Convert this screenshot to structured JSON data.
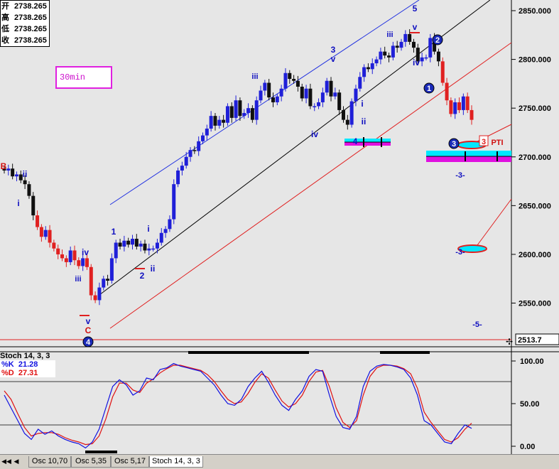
{
  "ohlc": {
    "open_label": "开",
    "open": "2738.265",
    "high_label": "高",
    "high": "2738.265",
    "low_label": "低",
    "low": "2738.265",
    "close_label": "收",
    "close": "2738.265"
  },
  "timeframe": "30min",
  "price_axis": {
    "ticks": [
      "2850.000",
      "2800.000",
      "2750.000",
      "2700.000",
      "2650.000",
      "2600.000",
      "2550.000"
    ],
    "current_price_tag": "2513.7",
    "ylim": [
      2505,
      2863
    ]
  },
  "stoch_axis": {
    "ticks": [
      "100.00",
      "50.00",
      "0.00"
    ]
  },
  "stoch_info": {
    "title": "Stoch 14, 3, 3",
    "k_label": "%K",
    "k_value": "21.28",
    "d_label": "%D",
    "d_value": "27.31"
  },
  "tabs": [
    "Osc 10,70",
    "Osc 5,35",
    "Osc 5,17",
    "Stoch 14, 3, 3"
  ],
  "active_tab": "Stoch 14, 3, 3",
  "wave_labels": [
    {
      "text": "B",
      "color": "#d01010"
    },
    {
      "text": "ii",
      "color": "#1010c0"
    },
    {
      "text": "i",
      "color": "#1010c0"
    },
    {
      "text": "iv",
      "color": "#1010c0"
    },
    {
      "text": "iii",
      "color": "#1010c0"
    },
    {
      "text": "v",
      "color": "#1010c0"
    },
    {
      "text": "C",
      "color": "#d01010"
    },
    {
      "text": "1",
      "color": "#1010c0"
    },
    {
      "text": "2",
      "color": "#1010c0"
    },
    {
      "text": "i",
      "color": "#1010c0"
    },
    {
      "text": "ii",
      "color": "#1010c0"
    },
    {
      "text": "iii",
      "color": "#1010c0"
    },
    {
      "text": "3",
      "color": "#1010c0"
    },
    {
      "text": "v",
      "color": "#1010c0"
    },
    {
      "text": "iv",
      "color": "#1010c0"
    },
    {
      "text": "4",
      "color": "#1010c0"
    },
    {
      "text": "i",
      "color": "#1010c0"
    },
    {
      "text": "ii",
      "color": "#1010c0"
    },
    {
      "text": "iii",
      "color": "#1010c0"
    },
    {
      "text": "v",
      "color": "#1010c0"
    },
    {
      "text": "5",
      "color": "#1010c0"
    },
    {
      "text": "iv",
      "color": "#1010c0"
    },
    {
      "text": "-3-",
      "color": "#1010c0"
    },
    {
      "text": "-3-",
      "color": "#1010c0"
    },
    {
      "text": "-5-",
      "color": "#1010c0"
    },
    {
      "text": "PTI",
      "color": "#d01010"
    }
  ],
  "circle_labels": [
    "4",
    "1",
    "2",
    "3"
  ],
  "colors": {
    "up": "#1f1fd8",
    "down": "#101010",
    "warn": "#e02020",
    "k": "#1010e0",
    "d": "#e01010",
    "cyan": "#00e8ff",
    "magenta": "#e010e0"
  },
  "chart_data": [
    {
      "type": "line",
      "title": "",
      "xlabel": "",
      "ylabel": "",
      "ylim": [
        2505,
        2863
      ],
      "series": [
        {
          "name": "",
          "values": [
            2686,
            2688,
            2680,
            2682,
            2676,
            2672,
            2660,
            2640,
            2628,
            2618,
            2625,
            2612,
            2606,
            2600,
            2596,
            2592,
            2604,
            2594,
            2588,
            2596,
            2587,
            2558,
            2553,
            2566,
            2575,
            2573,
            2596,
            2612,
            2608,
            2614,
            2610,
            2616,
            2608,
            2611,
            2604,
            2606,
            2606,
            2612,
            2622,
            2626,
            2636,
            2672,
            2686,
            2691,
            2700,
            2707,
            2706,
            2716,
            2722,
            2729,
            2742,
            2732,
            2738,
            2735,
            2752,
            2740,
            2758,
            2742,
            2745,
            2750,
            2738,
            2758,
            2768,
            2776,
            2761,
            2756,
            2762,
            2770,
            2786,
            2780,
            2778,
            2772,
            2760,
            2770,
            2752,
            2752,
            2756,
            2766,
            2778,
            2762,
            2766,
            2748,
            2738,
            2733,
            2757,
            2770,
            2782,
            2792,
            2790,
            2796,
            2800,
            2808,
            2804,
            2802,
            2814,
            2812,
            2818,
            2826,
            2818,
            2812,
            2798,
            2802,
            2802,
            2822,
            2808,
            2798,
            2776,
            2758,
            2744,
            2756,
            2748,
            2762,
            2748,
            2738
          ]
        }
      ]
    },
    {
      "type": "line",
      "title": "Stoch 14, 3, 3",
      "ylim": [
        -10,
        110
      ],
      "series": [
        {
          "name": "%K",
          "values": [
            60,
            45,
            30,
            15,
            8,
            20,
            14,
            18,
            12,
            8,
            5,
            3,
            -2,
            5,
            20,
            45,
            70,
            78,
            72,
            60,
            65,
            80,
            78,
            90,
            92,
            97,
            94,
            92,
            90,
            88,
            80,
            72,
            60,
            50,
            48,
            55,
            70,
            80,
            88,
            75,
            60,
            48,
            42,
            55,
            65,
            82,
            90,
            88,
            60,
            35,
            22,
            20,
            35,
            70,
            88,
            94,
            96,
            95,
            93,
            90,
            80,
            60,
            30,
            25,
            15,
            5,
            3,
            15,
            25,
            21
          ]
        },
        {
          "name": "%D",
          "values": [
            65,
            55,
            38,
            22,
            12,
            15,
            16,
            16,
            14,
            10,
            7,
            5,
            2,
            3,
            12,
            32,
            58,
            74,
            74,
            66,
            63,
            74,
            79,
            86,
            91,
            95,
            95,
            93,
            91,
            89,
            84,
            76,
            65,
            55,
            50,
            52,
            62,
            75,
            85,
            80,
            66,
            53,
            46,
            50,
            60,
            76,
            87,
            89,
            70,
            45,
            28,
            22,
            30,
            60,
            82,
            92,
            95,
            95,
            94,
            91,
            85,
            68,
            40,
            28,
            18,
            8,
            5,
            10,
            20,
            27
          ]
        }
      ]
    }
  ]
}
